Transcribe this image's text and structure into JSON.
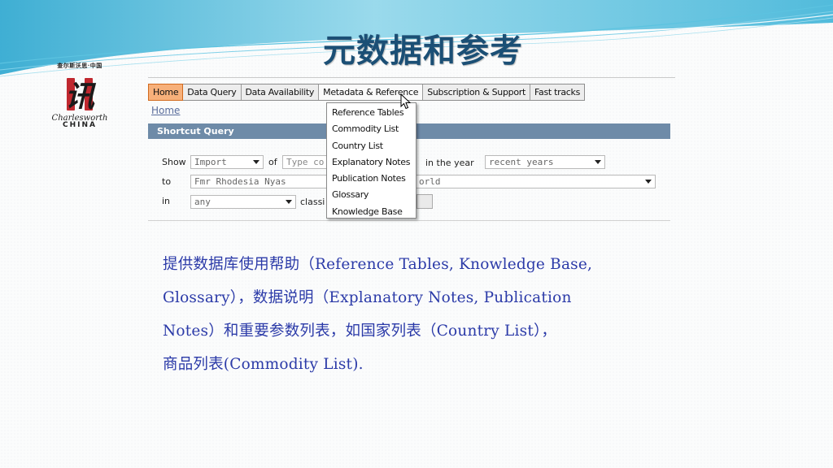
{
  "slide": {
    "title": "元数据和参考",
    "accent_color": "#1b4f75",
    "text_color": "#2b3aa8"
  },
  "logo": {
    "top_text": "查尔斯沃思·中国",
    "mark_char": "讯",
    "script_text": "Charlesworth",
    "word": "CHINA"
  },
  "nav": {
    "tabs": [
      {
        "label": "Home"
      },
      {
        "label": "Data Query"
      },
      {
        "label": "Data Availability"
      },
      {
        "label": "Metadata & Reference"
      },
      {
        "label": "Subscription & Support"
      },
      {
        "label": "Fast tracks"
      }
    ]
  },
  "breadcrumb": {
    "home": "Home"
  },
  "shortcut_query": {
    "header": "Shortcut Query",
    "show_label": "Show",
    "show_value": "Import",
    "of_label": "of",
    "of_placeholder": "Type co",
    "year_label": "in the year",
    "year_value": "recent years",
    "to_label": "to",
    "to_value": "Fmr Rhodesia Nyas",
    "partner_value": "orld",
    "in_label": "in",
    "in_value": "any",
    "classif_label": "classi"
  },
  "dropdown": {
    "items": [
      "Reference Tables",
      "Commodity List",
      "Country List",
      "Explanatory Notes",
      "Publication Notes",
      "Glossary",
      "Knowledge Base"
    ]
  },
  "description": {
    "lines": [
      "提供数据库使用帮助（Reference Tables, Knowledge Base,",
      "Glossary），数据说明（Explanatory Notes, Publication",
      "Notes）和重要参数列表，如国家列表（Country List），",
      "商品列表(Commodity List)."
    ]
  }
}
